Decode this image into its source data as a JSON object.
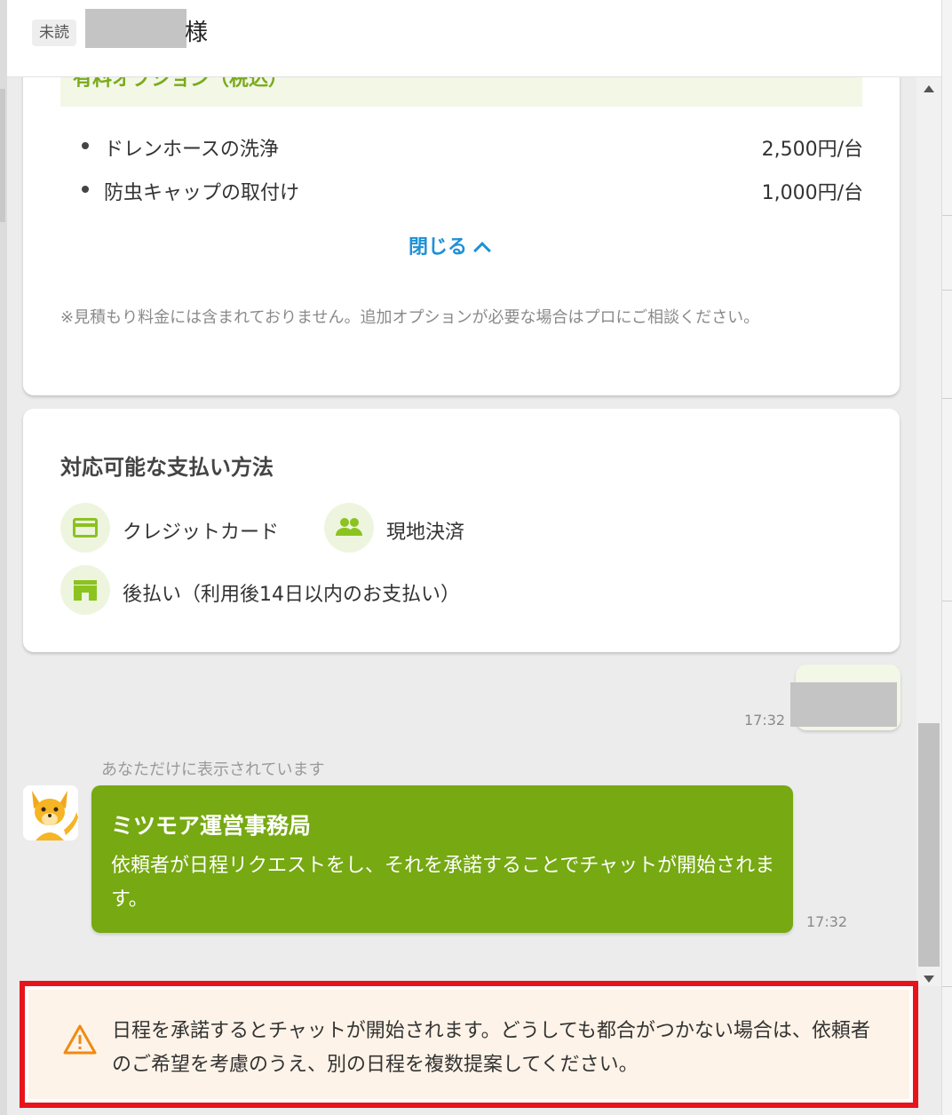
{
  "header": {
    "unread_badge": "未読",
    "customer_suffix": "様"
  },
  "options": {
    "heading": "有料オプション（税込）",
    "items": [
      {
        "label": "ドレンホースの洗浄",
        "price": "2,500円/台"
      },
      {
        "label": "防虫キャップの取付け",
        "price": "1,000円/台"
      }
    ],
    "close_label": "閉じる",
    "note": "※見積もり料金には含まれておりません。追加オプションが必要な場合はプロにご相談ください。"
  },
  "payments": {
    "title": "対応可能な支払い方法",
    "methods": [
      {
        "label": "クレジットカード",
        "icon": "credit-card-icon"
      },
      {
        "label": "現地決済",
        "icon": "people-icon"
      },
      {
        "label": "後払い（利用後14日以内のお支払い）",
        "icon": "convenience-store-icon"
      }
    ]
  },
  "my_message": {
    "time": "17:32"
  },
  "system": {
    "notice": "あなただけに表示されています",
    "sender": "ミツモア運営事務局",
    "message": "依頼者が日程リクエストをし、それを承諾することでチャットが開始されます。",
    "time": "17:32"
  },
  "alert": {
    "icon": "warning-icon",
    "text": "日程を承諾するとチャットが開始されます。どうしても都合がつかない場合は、依頼者のご希望を考慮のうえ、別の日程を複数提案してください。"
  },
  "colors": {
    "brand_green": "#76a912",
    "link_blue": "#1e90d6",
    "alert_border": "#e8141c",
    "alert_background": "#fef3e8"
  }
}
